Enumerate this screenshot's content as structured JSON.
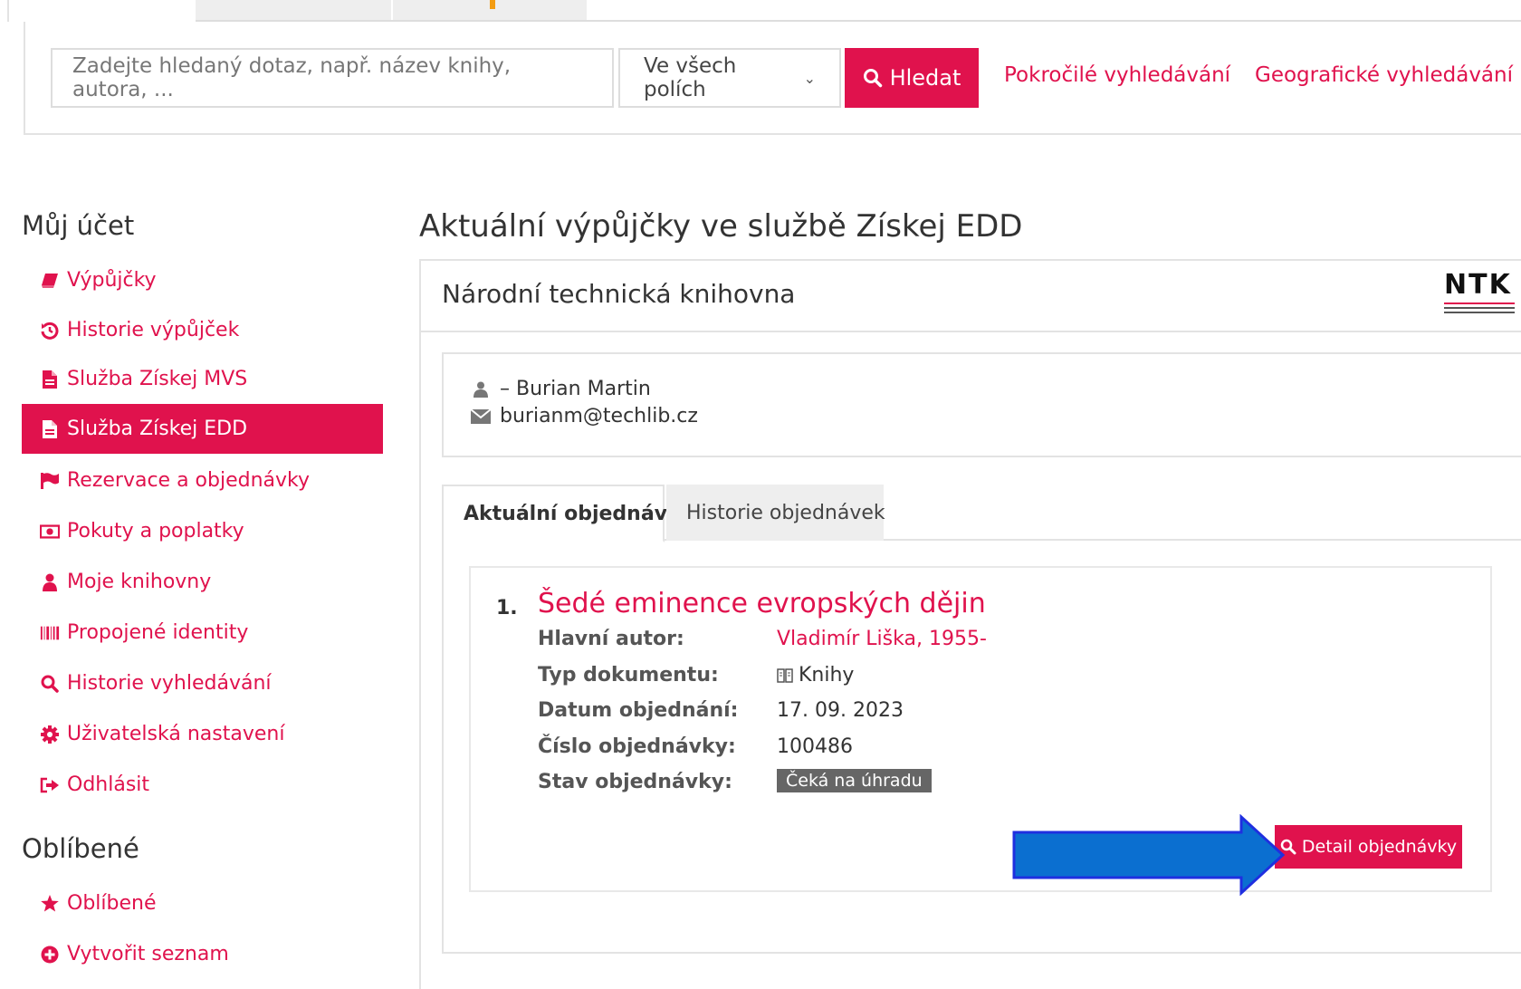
{
  "search": {
    "placeholder": "Zadejte hledaný dotaz, např. název knihy, autora, ...",
    "scope": "Ve všech polích",
    "button": "Hledat",
    "advanced": "Pokročilé vyhledávání",
    "geographic": "Geografické vyhledávání"
  },
  "sidebar": {
    "account_heading": "Můj účet",
    "items": [
      {
        "label": "Výpůjčky",
        "icon": "book-icon"
      },
      {
        "label": "Historie výpůjček",
        "icon": "history-icon"
      },
      {
        "label": "Služba Získej MVS",
        "icon": "file-icon"
      },
      {
        "label": "Služba Získej EDD",
        "icon": "file-icon",
        "active": true
      },
      {
        "label": "Rezervace a objednávky",
        "icon": "flag-icon"
      },
      {
        "label": "Pokuty a poplatky",
        "icon": "money-icon"
      },
      {
        "label": "Moje knihovny",
        "icon": "user-icon"
      },
      {
        "label": "Propojené identity",
        "icon": "barcode-icon"
      },
      {
        "label": "Historie vyhledávání",
        "icon": "search-icon"
      },
      {
        "label": "Uživatelská nastavení",
        "icon": "gear-icon"
      },
      {
        "label": "Odhlásit",
        "icon": "sign-out-icon"
      }
    ],
    "favorites_heading": "Oblíbené",
    "favorites": [
      {
        "label": "Oblíbené",
        "icon": "star-icon"
      },
      {
        "label": "Vytvořit seznam",
        "icon": "plus-circle-icon"
      }
    ]
  },
  "main": {
    "title": "Aktuální výpůjčky ve službě Získej EDD",
    "library": "Národní technická knihovna",
    "logo_text": "NTK",
    "user": {
      "name": "– Burian Martin",
      "email": "burianm@techlib.cz"
    },
    "tabs": [
      "Aktuální objednávky",
      "Historie objednávek"
    ],
    "order": {
      "number": "1.",
      "title": "Šedé eminence evropských dějin",
      "fields": [
        {
          "label": "Hlavní autor:",
          "value": "Vladimír Liška, 1955-"
        },
        {
          "label": "Typ dokumentu:",
          "value": "Knihy"
        },
        {
          "label": "Datum objednání:",
          "value": "17. 09. 2023"
        },
        {
          "label": "Číslo objednávky:",
          "value": "100486"
        },
        {
          "label": "Stav objednávky:",
          "value": "Čeká na úhradu"
        }
      ],
      "detail_button": "Detail objednávky"
    }
  },
  "colors": {
    "accent": "#e0124d",
    "arrow": "#0b6fd0",
    "arrow_border": "#1f2fe0",
    "badge": "#666666"
  }
}
